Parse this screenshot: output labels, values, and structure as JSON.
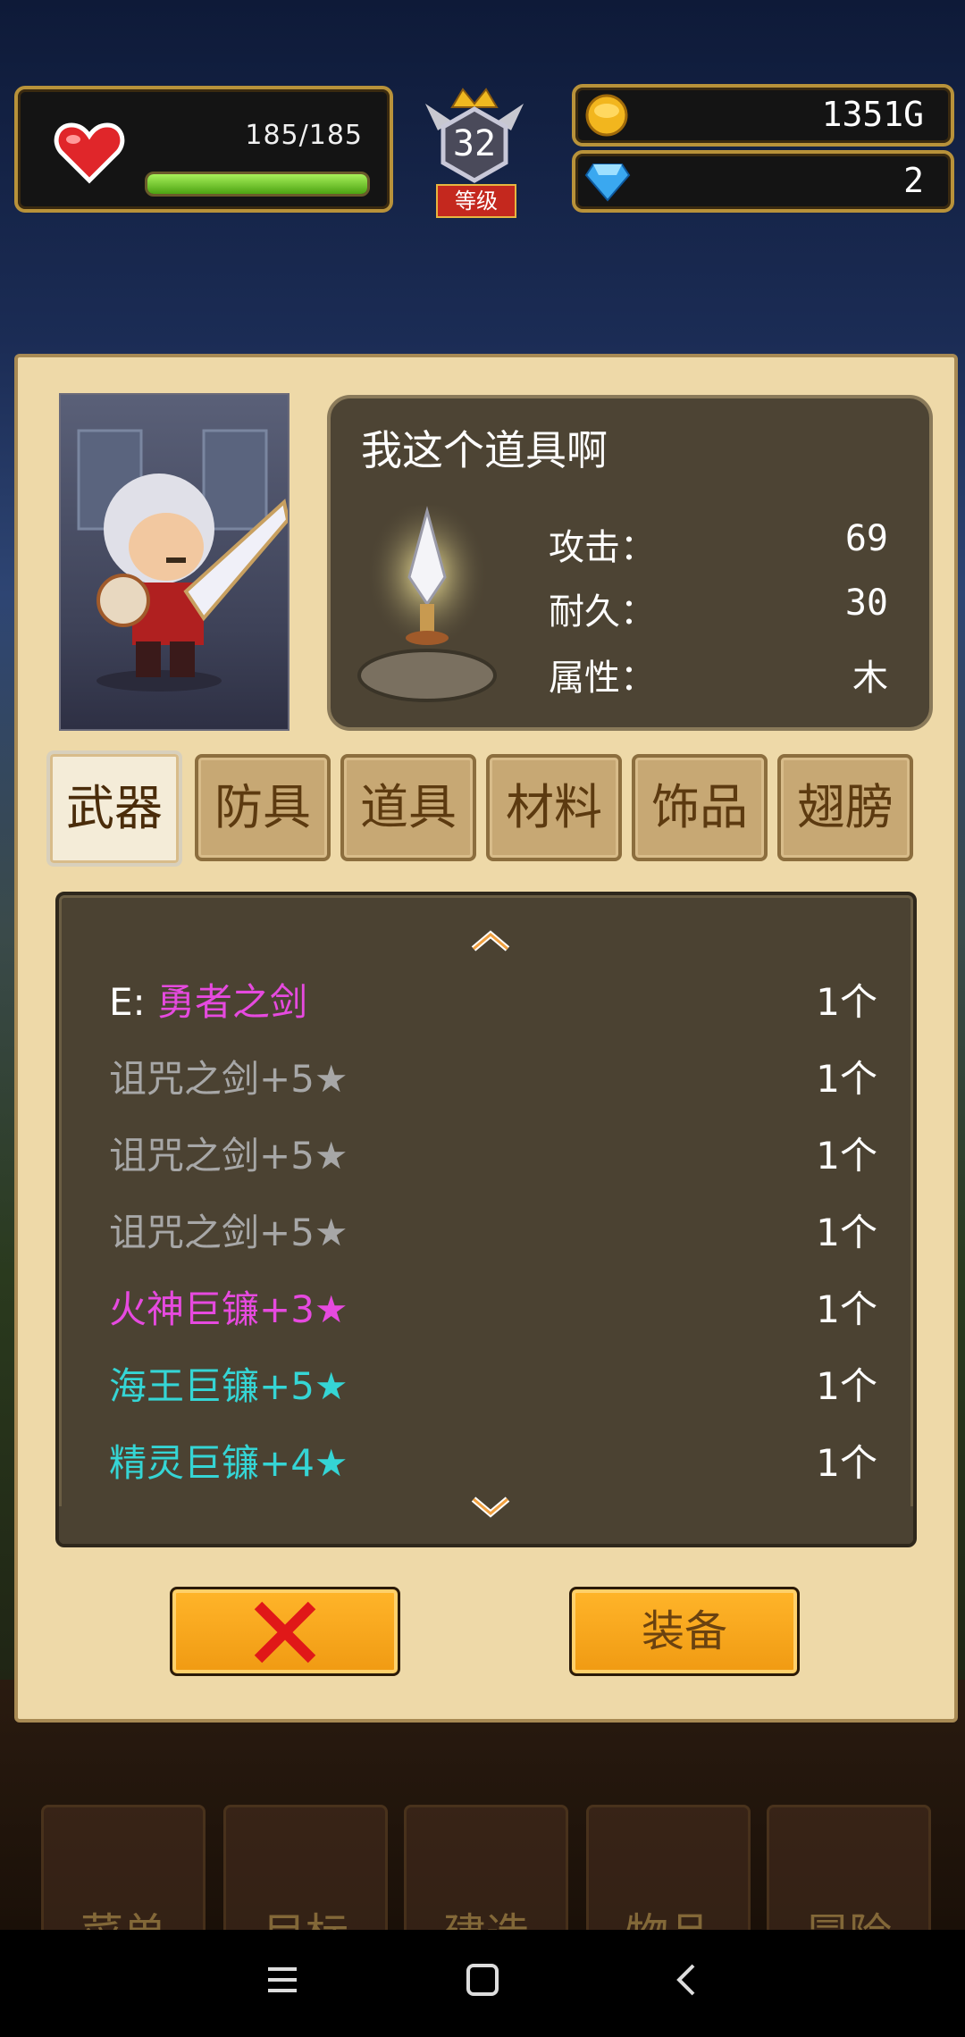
{
  "hud": {
    "hp": {
      "current": 185,
      "max": 185,
      "text": "185/185",
      "fill": 1.0
    },
    "level": {
      "value": "32",
      "label": "等级"
    },
    "gold": "1351G",
    "gems": "2"
  },
  "item_info": {
    "title": "我这个道具啊",
    "stats": [
      {
        "label": "攻击：",
        "value": "69"
      },
      {
        "label": "耐久：",
        "value": "30"
      },
      {
        "label": "属性：",
        "value": "木"
      }
    ]
  },
  "tabs": [
    "武器",
    "防具",
    "道具",
    "材料",
    "饰品",
    "翅膀"
  ],
  "active_tab": 0,
  "items": [
    {
      "prefix": "E: ",
      "name": "勇者之剑",
      "count": "1个",
      "color": "#e64adf"
    },
    {
      "prefix": "",
      "name": "诅咒之剑+5★",
      "count": "1个",
      "color": "#a7a7a7"
    },
    {
      "prefix": "",
      "name": "诅咒之剑+5★",
      "count": "1个",
      "color": "#a7a7a7"
    },
    {
      "prefix": "",
      "name": "诅咒之剑+5★",
      "count": "1个",
      "color": "#a7a7a7"
    },
    {
      "prefix": "",
      "name": "火神巨镰+3★",
      "count": "1个",
      "color": "#e64adf"
    },
    {
      "prefix": "",
      "name": "海王巨镰+5★",
      "count": "1个",
      "color": "#35d5d5"
    },
    {
      "prefix": "",
      "name": "精灵巨镰+4★",
      "count": "1个",
      "color": "#35d5d5"
    }
  ],
  "buttons": {
    "equip": "装备"
  },
  "bottom_menu": [
    "菜单",
    "目标",
    "建造",
    "物品",
    "冒险"
  ],
  "colors": {
    "panel": "#eed9a8",
    "list_bg": "#4b4232",
    "button": "#f5a31a",
    "cancel_x": "#e01818"
  }
}
